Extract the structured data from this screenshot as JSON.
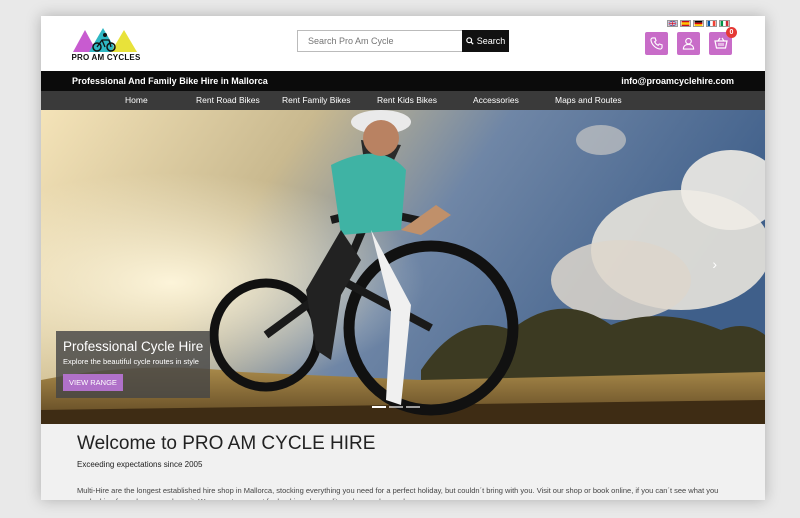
{
  "logo": {
    "text": "PRO AM CYCLES"
  },
  "search": {
    "placeholder": "Search Pro Am Cycle",
    "button_label": "Search"
  },
  "flags": [
    "english-flag",
    "spanish-flag",
    "german-flag",
    "french-flag",
    "italian-flag"
  ],
  "header_icons": {
    "phone": "phone-icon",
    "account": "user-icon",
    "cart": "cart-icon",
    "cart_count": "0"
  },
  "topbar": {
    "tagline": "Professional And Family Bike Hire in Mallorca",
    "email": "info@proamcyclehire.com"
  },
  "nav": {
    "items": [
      "Home",
      "Rent Road Bikes",
      "Rent Family Bikes",
      "Rent Kids Bikes",
      "Accessories",
      "Maps and Routes"
    ]
  },
  "hero": {
    "title": "Professional Cycle Hire",
    "subtitle": "Explore the beautiful cycle routes in style",
    "button_label": "VIEW RANGE",
    "next_arrow": "›"
  },
  "welcome": {
    "title": "Welcome to PRO AM CYCLE HIRE",
    "subtitle": "Exceeding expectations since 2005",
    "body": "Multi-Hire are the longest established hire shop in Mallorca, stocking everything you need for a perfect holiday, but couldn´t bring with you. Visit our shop or book online, if you can´t see what you are looking for, ask, we may have it. We accept payment for bookings by credit card, paypal or cash."
  },
  "colors": {
    "accent": "#c86cc8",
    "button": "#b071c9",
    "topbar": "#0b0b0b",
    "nav": "#3a3a3a"
  }
}
